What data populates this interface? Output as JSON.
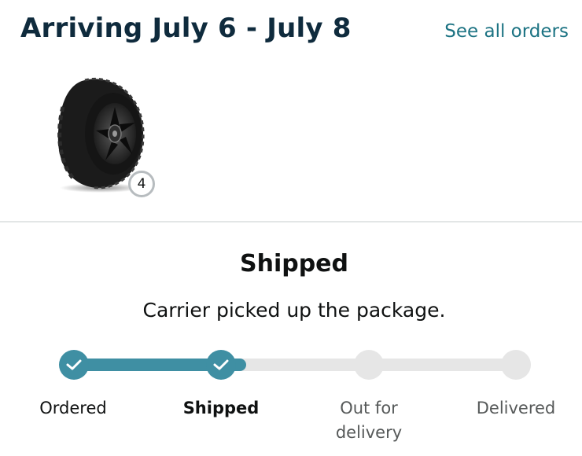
{
  "header": {
    "title": "Arriving July 6 - July 8",
    "see_all_label": "See all orders"
  },
  "item": {
    "image_icon": "tire-image",
    "quantity": "4"
  },
  "status": {
    "title": "Shipped",
    "description": "Carrier picked up the package."
  },
  "progress": {
    "fraction_complete": 0.39,
    "steps": [
      {
        "label": "Ordered",
        "state": "done"
      },
      {
        "label": "Shipped",
        "state": "current"
      },
      {
        "label": "Out for delivery",
        "state": "pending"
      },
      {
        "label": "Delivered",
        "state": "pending"
      }
    ]
  },
  "colors": {
    "title_text": "#0f2b3d",
    "link": "#1c7383",
    "progress_active": "#3f8fa3",
    "progress_inactive": "#e6e6e6",
    "badge_border": "#b7bcbf"
  }
}
